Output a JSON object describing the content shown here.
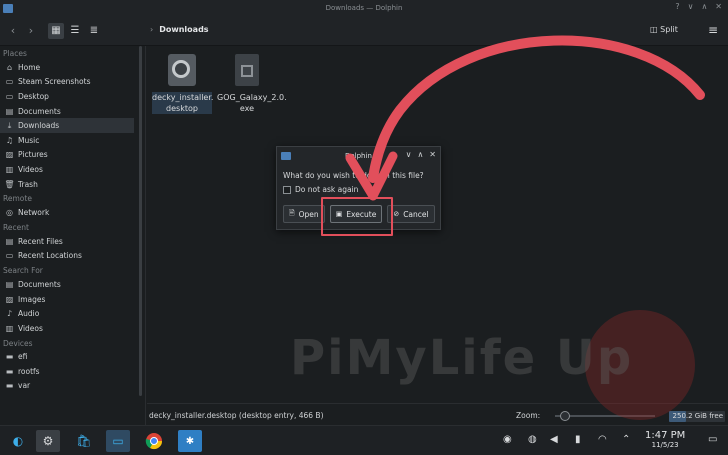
{
  "window": {
    "title": "Downloads — Dolphin",
    "help_btn": "?",
    "min_btn": "∨",
    "max_btn": "∧",
    "close_btn": "✕"
  },
  "toolbar": {
    "back": "‹",
    "forward": "›",
    "breadcrumb": "Downloads",
    "split_label": "Split"
  },
  "sidebar": {
    "sections": [
      {
        "title": "Places",
        "items": [
          {
            "label": "Home",
            "icon": "home-icon",
            "glyph": "⌂"
          },
          {
            "label": "Steam Screenshots",
            "icon": "folder-icon",
            "glyph": "▭"
          },
          {
            "label": "Desktop",
            "icon": "desktop-icon",
            "glyph": "▭"
          },
          {
            "label": "Documents",
            "icon": "documents-icon",
            "glyph": "▤"
          },
          {
            "label": "Downloads",
            "icon": "downloads-icon",
            "glyph": "⤓"
          },
          {
            "label": "Music",
            "icon": "music-icon",
            "glyph": "♫"
          },
          {
            "label": "Pictures",
            "icon": "pictures-icon",
            "glyph": "▨"
          },
          {
            "label": "Videos",
            "icon": "videos-icon",
            "glyph": "▥"
          },
          {
            "label": "Trash",
            "icon": "trash-icon",
            "glyph": "🗑"
          }
        ]
      },
      {
        "title": "Remote",
        "items": [
          {
            "label": "Network",
            "icon": "network-icon",
            "glyph": "◎"
          }
        ]
      },
      {
        "title": "Recent",
        "items": [
          {
            "label": "Recent Files",
            "icon": "recent-files-icon",
            "glyph": "▤"
          },
          {
            "label": "Recent Locations",
            "icon": "recent-locations-icon",
            "glyph": "▭"
          }
        ]
      },
      {
        "title": "Search For",
        "items": [
          {
            "label": "Documents",
            "icon": "documents-icon",
            "glyph": "▤"
          },
          {
            "label": "Images",
            "icon": "images-icon",
            "glyph": "▨"
          },
          {
            "label": "Audio",
            "icon": "audio-icon",
            "glyph": "♪"
          },
          {
            "label": "Videos",
            "icon": "videos-icon",
            "glyph": "▥"
          }
        ]
      },
      {
        "title": "Devices",
        "items": [
          {
            "label": "efi",
            "icon": "drive-icon",
            "glyph": "▬"
          },
          {
            "label": "rootfs",
            "icon": "drive-icon",
            "glyph": "▬"
          },
          {
            "label": "var",
            "icon": "drive-icon",
            "glyph": "▬"
          }
        ]
      }
    ]
  },
  "files": [
    {
      "name": "decky_installer.desktop",
      "line1": "decky_installer.",
      "line2": "desktop"
    },
    {
      "name": "GOG_Galaxy_2.0.exe",
      "line1": "GOG_Galaxy_2.0.",
      "line2": "exe"
    }
  ],
  "dialog": {
    "title": "Dolphin",
    "question": "What do you wish to do with this file?",
    "checkbox_label": "Do not ask again",
    "open_label": "Open",
    "execute_label": "Execute",
    "cancel_label": "Cancel"
  },
  "status": {
    "text": "decky_installer.desktop (desktop entry, 466 B)",
    "zoom_label": "Zoom:",
    "free_space": "250.2 GiB free"
  },
  "clock": {
    "time": "1:47 PM",
    "date": "11/5/23"
  },
  "watermark": "PiMyLife Up",
  "colors": {
    "accent": "#3daee9",
    "annotation": "#e24f5b",
    "background": "#1b1e20"
  }
}
